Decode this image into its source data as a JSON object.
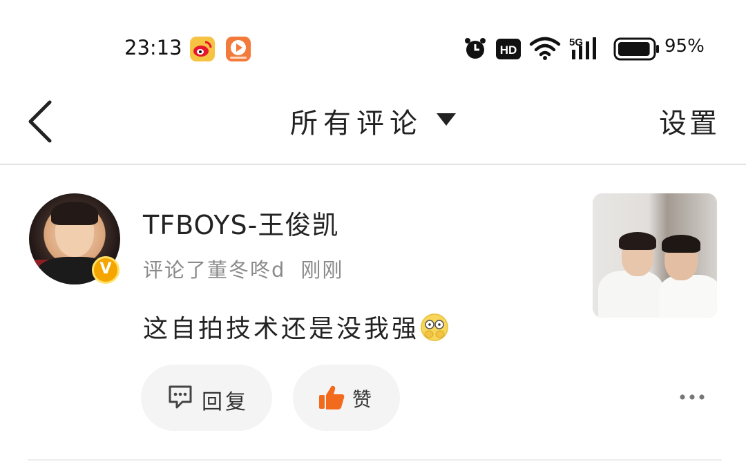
{
  "status_bar": {
    "time": "23:13",
    "battery_percent": "95%",
    "network": "5G",
    "hd_label": "HD",
    "icons": [
      "weibo-app-icon",
      "video-app-icon",
      "alarm-icon",
      "hd-icon",
      "wifi-icon",
      "signal-icon",
      "battery-icon"
    ],
    "battery_level": 0.95
  },
  "header": {
    "title": "所有评论",
    "settings_label": "设置",
    "back_icon": "chevron-left-icon",
    "dropdown_icon": "triangle-down-icon"
  },
  "comment": {
    "username": "TFBOYS-王俊凯",
    "verified_badge": "V",
    "action_text": "评论了董冬咚d",
    "timestamp": "刚刚",
    "text": "这自拍技术还是没我强",
    "emoji": "hug-emoji",
    "reply_label": "回复",
    "like_label": "赞",
    "colors": {
      "like_icon": "#f26b1d",
      "badge": "#f5a500"
    }
  }
}
